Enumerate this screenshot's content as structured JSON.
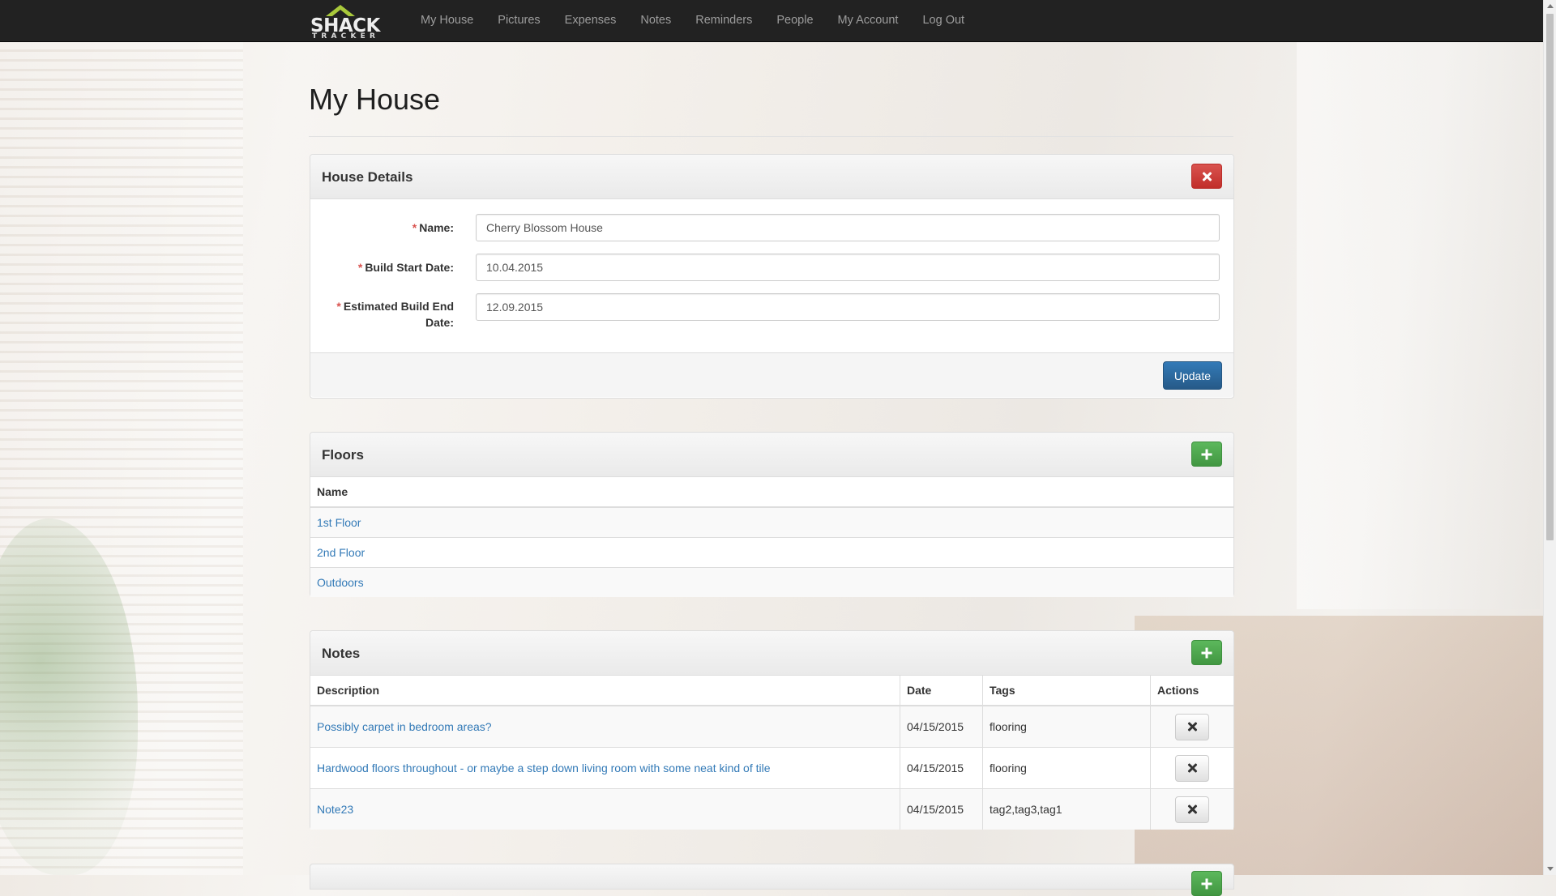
{
  "brand": {
    "word1": "SHACK",
    "word2": "TRACKER"
  },
  "nav": {
    "items": [
      "My House",
      "Pictures",
      "Expenses",
      "Notes",
      "Reminders",
      "People",
      "My Account",
      "Log Out"
    ]
  },
  "page": {
    "title": "My House"
  },
  "house_details": {
    "title": "House Details",
    "fields": [
      {
        "label": "Name:",
        "value": "Cherry Blossom House",
        "required": "*"
      },
      {
        "label": "Build Start Date:",
        "value": "10.04.2015",
        "required": "*"
      },
      {
        "label": "Estimated Build End Date:",
        "value": "12.09.2015",
        "required": "*"
      }
    ],
    "update_label": "Update"
  },
  "floors": {
    "title": "Floors",
    "header": "Name",
    "rows": [
      "1st Floor",
      "2nd Floor",
      "Outdoors"
    ]
  },
  "notes": {
    "title": "Notes",
    "headers": [
      "Description",
      "Date",
      "Tags",
      "Actions"
    ],
    "rows": [
      {
        "description": "Possibly carpet in bedroom areas?",
        "date": "04/15/2015",
        "tags": "flooring"
      },
      {
        "description": "Hardwood floors throughout - or maybe a step down living room with some neat kind of tile",
        "date": "04/15/2015",
        "tags": "flooring"
      },
      {
        "description": "Note23",
        "date": "04/15/2015",
        "tags": "tag2,tag3,tag1"
      }
    ]
  },
  "colors": {
    "navbar": "#222222",
    "link": "#337ab7",
    "danger": "#d9534f",
    "success": "#5cb85c",
    "primary": "#337ab7",
    "brand_roof": "#a9c93b"
  },
  "icons": {
    "close": "close-icon",
    "add": "plus-icon"
  }
}
